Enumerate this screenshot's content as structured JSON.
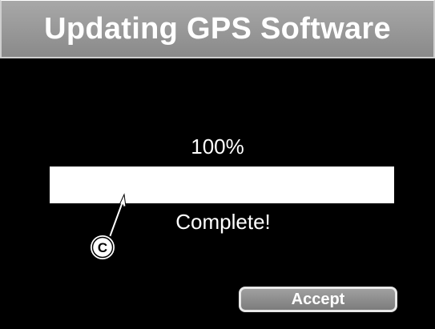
{
  "window": {
    "title": "Updating GPS Software"
  },
  "progress": {
    "percent_label": "100%",
    "fraction": 1.0,
    "status": "Complete!"
  },
  "callout": {
    "letter": "C"
  },
  "footer": {
    "accept_label": "Accept"
  },
  "colors": {
    "background": "#000000",
    "title_bar": "#9a9a9a",
    "progress_fill": "#ffffff",
    "button": "#8e8e8e"
  }
}
